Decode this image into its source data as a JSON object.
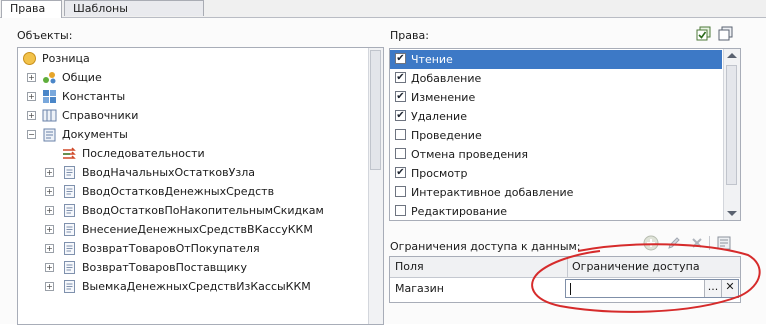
{
  "tabs": [
    {
      "label": "Права",
      "active": true
    },
    {
      "label": "Шаблоны ограничений",
      "active": false
    }
  ],
  "objects": {
    "caption": "Объекты:",
    "tree": [
      {
        "label": "Розница",
        "icon": "root-circle-icon",
        "level": 0,
        "expander": ""
      },
      {
        "label": "Общие",
        "icon": "common-icon",
        "level": 1,
        "expander": "+"
      },
      {
        "label": "Константы",
        "icon": "constants-icon",
        "level": 1,
        "expander": "+"
      },
      {
        "label": "Справочники",
        "icon": "catalogs-icon",
        "level": 1,
        "expander": "+"
      },
      {
        "label": "Документы",
        "icon": "documents-icon",
        "level": 1,
        "expander": "−"
      },
      {
        "label": "Последовательности",
        "icon": "sequences-icon",
        "level": 2,
        "expander": ""
      },
      {
        "label": "ВводНачальныхОстатковУзла",
        "icon": "document-icon",
        "level": 2,
        "expander": "+"
      },
      {
        "label": "ВводОстатковДенежныхСредств",
        "icon": "document-icon",
        "level": 2,
        "expander": "+"
      },
      {
        "label": "ВводОстатковПоНакопительнымСкидкам",
        "icon": "document-icon",
        "level": 2,
        "expander": "+"
      },
      {
        "label": "ВнесениеДенежныхСредствВКассуККМ",
        "icon": "document-icon",
        "level": 2,
        "expander": "+"
      },
      {
        "label": "ВозвратТоваровОтПокупателя",
        "icon": "document-icon",
        "level": 2,
        "expander": "+"
      },
      {
        "label": "ВозвратТоваровПоставщику",
        "icon": "document-icon",
        "level": 2,
        "expander": "+"
      },
      {
        "label": "ВыемкаДенежныхСредствИзКассыККМ",
        "icon": "document-icon",
        "level": 2,
        "expander": "+"
      }
    ]
  },
  "rights": {
    "caption": "Права:",
    "items": [
      {
        "label": "Чтение",
        "checked": true,
        "selected": true
      },
      {
        "label": "Добавление",
        "checked": true,
        "selected": false
      },
      {
        "label": "Изменение",
        "checked": true,
        "selected": false
      },
      {
        "label": "Удаление",
        "checked": true,
        "selected": false
      },
      {
        "label": "Проведение",
        "checked": false,
        "selected": false
      },
      {
        "label": "Отмена проведения",
        "checked": false,
        "selected": false
      },
      {
        "label": "Просмотр",
        "checked": true,
        "selected": false
      },
      {
        "label": "Интерактивное добавление",
        "checked": false,
        "selected": false
      },
      {
        "label": "Редактирование",
        "checked": false,
        "selected": false
      }
    ]
  },
  "restrictions": {
    "caption": "Ограничения доступа к данным:",
    "columns": {
      "field": "Поля",
      "restriction": "Ограничение доступа"
    },
    "rows": [
      {
        "field": "Магазин",
        "restriction": ""
      }
    ],
    "editor_buttons": {
      "choose": "...",
      "clear": "✕"
    }
  },
  "colors": {
    "selection": "#3d79c6",
    "annotation": "#d62b2b"
  }
}
